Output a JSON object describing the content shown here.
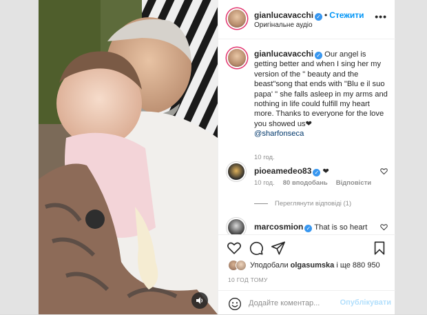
{
  "header": {
    "username": "gianlucavacchi",
    "follow_label": "Стежити",
    "separator": "•",
    "audio_label": "Оригінальне аудіо",
    "more_label": "•••"
  },
  "caption": {
    "username": "gianlucavacchi",
    "text": "Our angel is getting better and when I sing her my version of the \" beauty and the beast\"song that ends with \"Blu e il suo papa' \" she falls asleep in my arms and nothing in life could fulfill my heart more. Thanks to everyone for the love you showed us❤",
    "mention": "@sharfonseca",
    "time": "10 год."
  },
  "comments": [
    {
      "username": "pioeamedeo83",
      "text": "❤",
      "time": "10 год.",
      "likes": "80 вподобань",
      "reply_label": "Відповісти"
    },
    {
      "username": "marcosmion",
      "text": "That is so heart"
    }
  ],
  "view_replies": "Переглянути відповіді (1)",
  "likes": {
    "prefix": "Уподобали",
    "user": "olgasumska",
    "suffix": "і ще 880 950"
  },
  "post_time": "10 ГОД ТОМУ",
  "add_comment": {
    "placeholder": "Додайте коментар...",
    "publish_label": "Опублікувати"
  },
  "colors": {
    "accent": "#0095f6",
    "verified": "#3897f0",
    "publish_disabled": "#b2dffc"
  },
  "icons": [
    "heart-icon",
    "comment-icon",
    "share-icon",
    "bookmark-icon",
    "emoji-icon",
    "audio-icon",
    "verified-badge-icon",
    "more-options-icon"
  ]
}
